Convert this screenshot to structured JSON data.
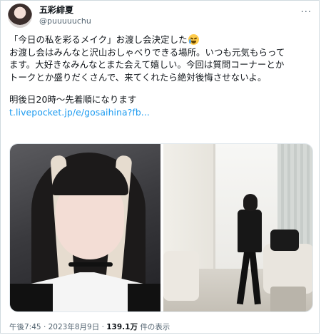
{
  "author": {
    "name": "五彩緋夏",
    "handle": "@puuuuuchu"
  },
  "header": {
    "more_label": "···"
  },
  "tweet": {
    "line1": "「今日の私を彩るメイク」お渡し会決定した",
    "line2": "お渡し会はみんなと沢山おしゃべりできる場所。いつも元気もらって",
    "line3": "ます。大好きなみんなとまた会えて嬉しい。今回は質問コーナーとか",
    "line4": "トークとか盛りだくさんで、来てくれたら絶対後悔させないよ。",
    "line5": "明後日20時〜先着順になります",
    "link": "t.livepocket.jp/e/gosaihina?fb..."
  },
  "emoji": {
    "name": "loudly-crying-face-icon",
    "color": "#ffcc4d"
  },
  "meta": {
    "time": "午後7:45",
    "separator": "·",
    "date": "2023年8月9日",
    "views_count": "139.1万",
    "views_label": "件の表示"
  },
  "colors": {
    "link": "#1d9bf0",
    "secondary_text": "#536471",
    "primary_text": "#0f1419"
  }
}
